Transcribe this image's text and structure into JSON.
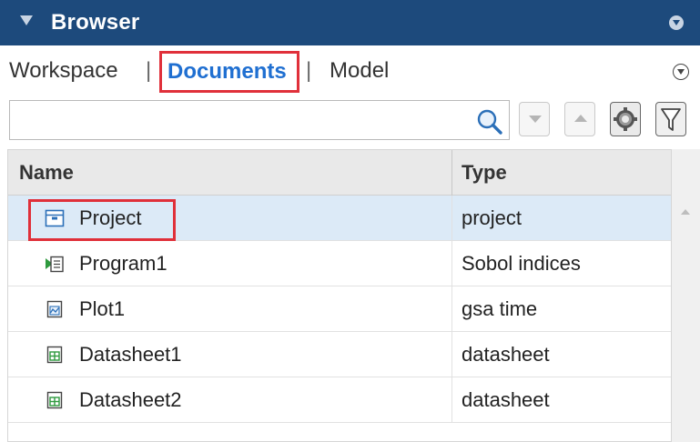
{
  "panel": {
    "title": "Browser"
  },
  "tabs": {
    "workspace": "Workspace",
    "separator": "|",
    "documents": "Documents",
    "model": "Model",
    "active": "Documents"
  },
  "search": {
    "value": "",
    "placeholder": ""
  },
  "toolbar": {
    "icons": [
      "search-icon",
      "move-down-icon",
      "move-up-icon",
      "settings-icon",
      "filter-icon"
    ]
  },
  "table": {
    "columns": [
      "Name",
      "Type"
    ],
    "rows": [
      {
        "name": "Project",
        "type": "project",
        "icon": "project-icon",
        "selected": true
      },
      {
        "name": "Program1",
        "type": "Sobol indices",
        "icon": "program-icon",
        "selected": false
      },
      {
        "name": "Plot1",
        "type": "gsa time",
        "icon": "plot-icon",
        "selected": false
      },
      {
        "name": "Datasheet1",
        "type": "datasheet",
        "icon": "datasheet-icon",
        "selected": false
      },
      {
        "name": "Datasheet2",
        "type": "datasheet",
        "icon": "datasheet-icon",
        "selected": false
      }
    ]
  },
  "colors": {
    "titlebar": "#1d4a7c",
    "active_tab": "#1f6fd1",
    "highlight_box": "#e0303a",
    "selected_row": "#dceaf7",
    "datasheet_icon": "#2e9a3e"
  }
}
